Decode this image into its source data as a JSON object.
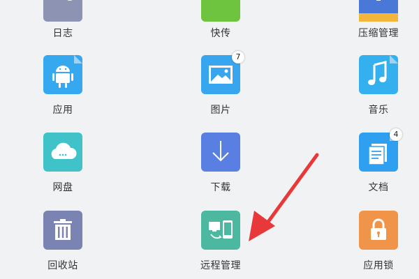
{
  "colors": {
    "accent_red": "#e8383a",
    "bg": "#f1f2f4"
  },
  "grid": [
    {
      "id": "rizhi",
      "label": "日志",
      "icon": "log-icon",
      "color": "#8d93b3",
      "badge": null
    },
    {
      "id": "kuaichuan",
      "label": "快传",
      "icon": "quick-transfer-icon",
      "color": "#6ec43f",
      "badge": null
    },
    {
      "id": "yasuo",
      "label": "压缩管理",
      "icon": "archive-icon",
      "color": "#4a78d8",
      "badge": null
    },
    {
      "id": "yingyong",
      "label": "应用",
      "icon": "android-icon",
      "color": "#35a8ef",
      "badge": null
    },
    {
      "id": "tupian",
      "label": "图片",
      "icon": "image-icon",
      "color": "#37a6ee",
      "badge": "7"
    },
    {
      "id": "yinyue",
      "label": "音乐",
      "icon": "music-icon",
      "color": "#35b0ef",
      "badge": null
    },
    {
      "id": "wangpan",
      "label": "网盘",
      "icon": "cloud-icon",
      "color": "#3fc2c8",
      "badge": null
    },
    {
      "id": "xiazai",
      "label": "下载",
      "icon": "download-icon",
      "color": "#5a7fe3",
      "badge": null
    },
    {
      "id": "wendang",
      "label": "文档",
      "icon": "document-icon",
      "color": "#2f9ff0",
      "badge": "4"
    },
    {
      "id": "huishouzhan",
      "label": "回收站",
      "icon": "trash-icon",
      "color": "#7b83b2",
      "badge": null
    },
    {
      "id": "yuancheng",
      "label": "远程管理",
      "icon": "remote-manage-icon",
      "color": "#4db8a0",
      "badge": null
    },
    {
      "id": "yingyongsuo",
      "label": "应用锁",
      "icon": "lock-icon",
      "color": "#f0944a",
      "badge": null
    }
  ]
}
